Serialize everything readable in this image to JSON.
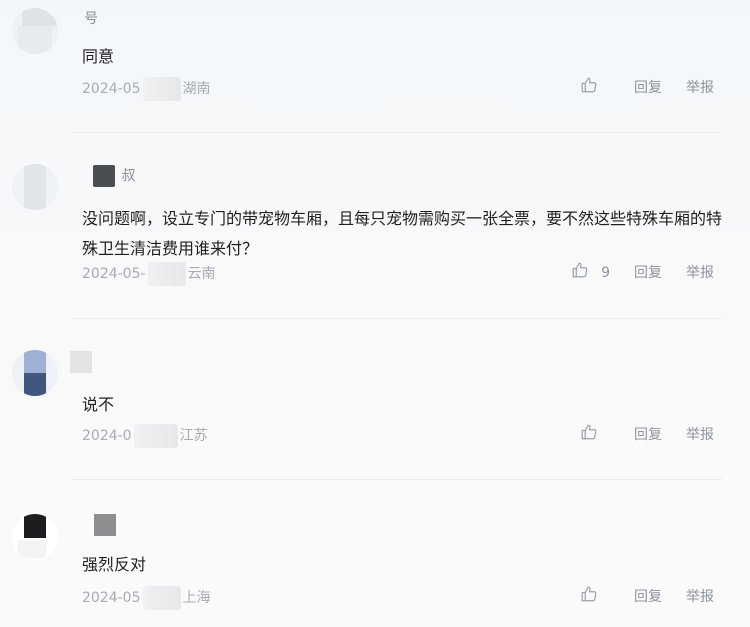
{
  "comments": [
    {
      "username": "号",
      "text": "同意",
      "date": "2024-05",
      "location": "湖南",
      "like_count": "",
      "reply_label": "回复",
      "report_label": "举报"
    },
    {
      "username": "叔",
      "text": "没问题啊，设立专门的带宠物车厢，且每只宠物需购买一张全票，要不然这些特殊车厢的特殊卫生清洁费用谁来付？",
      "date": "2024-05-",
      "location": "云南",
      "like_count": "9",
      "reply_label": "回复",
      "report_label": "举报"
    },
    {
      "username": "",
      "text": "说不",
      "date": "2024-0",
      "location": "江苏",
      "like_count": "",
      "reply_label": "回复",
      "report_label": "举报"
    },
    {
      "username": "",
      "text": "强烈反对",
      "date": "2024-05",
      "location": "上海",
      "like_count": "",
      "reply_label": "回复",
      "report_label": "举报"
    }
  ],
  "icons": {
    "like": "thumbs-up-icon"
  },
  "colors": {
    "text": "#1f1f1f",
    "meta": "#a7abb2",
    "action": "#8f949c",
    "divider": "#ececee"
  }
}
